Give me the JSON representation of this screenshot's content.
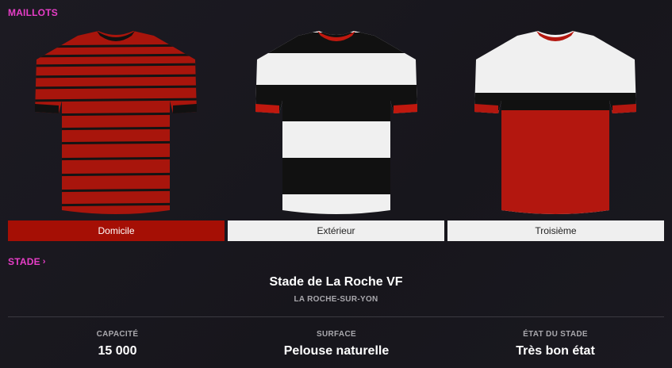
{
  "kits": {
    "section_title": "MAILLOTS",
    "items": [
      {
        "label": "Domicile",
        "primary": "#a8150c",
        "secondary": "#111111",
        "pattern": "thin-stripes"
      },
      {
        "label": "Extérieur",
        "primary": "#f0f0f0",
        "secondary": "#111111",
        "trim": "#c0180e",
        "pattern": "wide-hoops"
      },
      {
        "label": "Troisième",
        "primary": "#f0f0f0",
        "secondary": "#b3170f",
        "band": "#111111",
        "pattern": "halves-band"
      }
    ]
  },
  "stadium": {
    "section_title": "STADE",
    "name": "Stade de La Roche VF",
    "city": "LA ROCHE-SUR-YON",
    "stats": [
      {
        "label": "CAPACITÉ",
        "value": "15 000"
      },
      {
        "label": "SURFACE",
        "value": "Pelouse naturelle"
      },
      {
        "label": "ÉTAT DU STADE",
        "value": "Très bon état"
      }
    ]
  }
}
